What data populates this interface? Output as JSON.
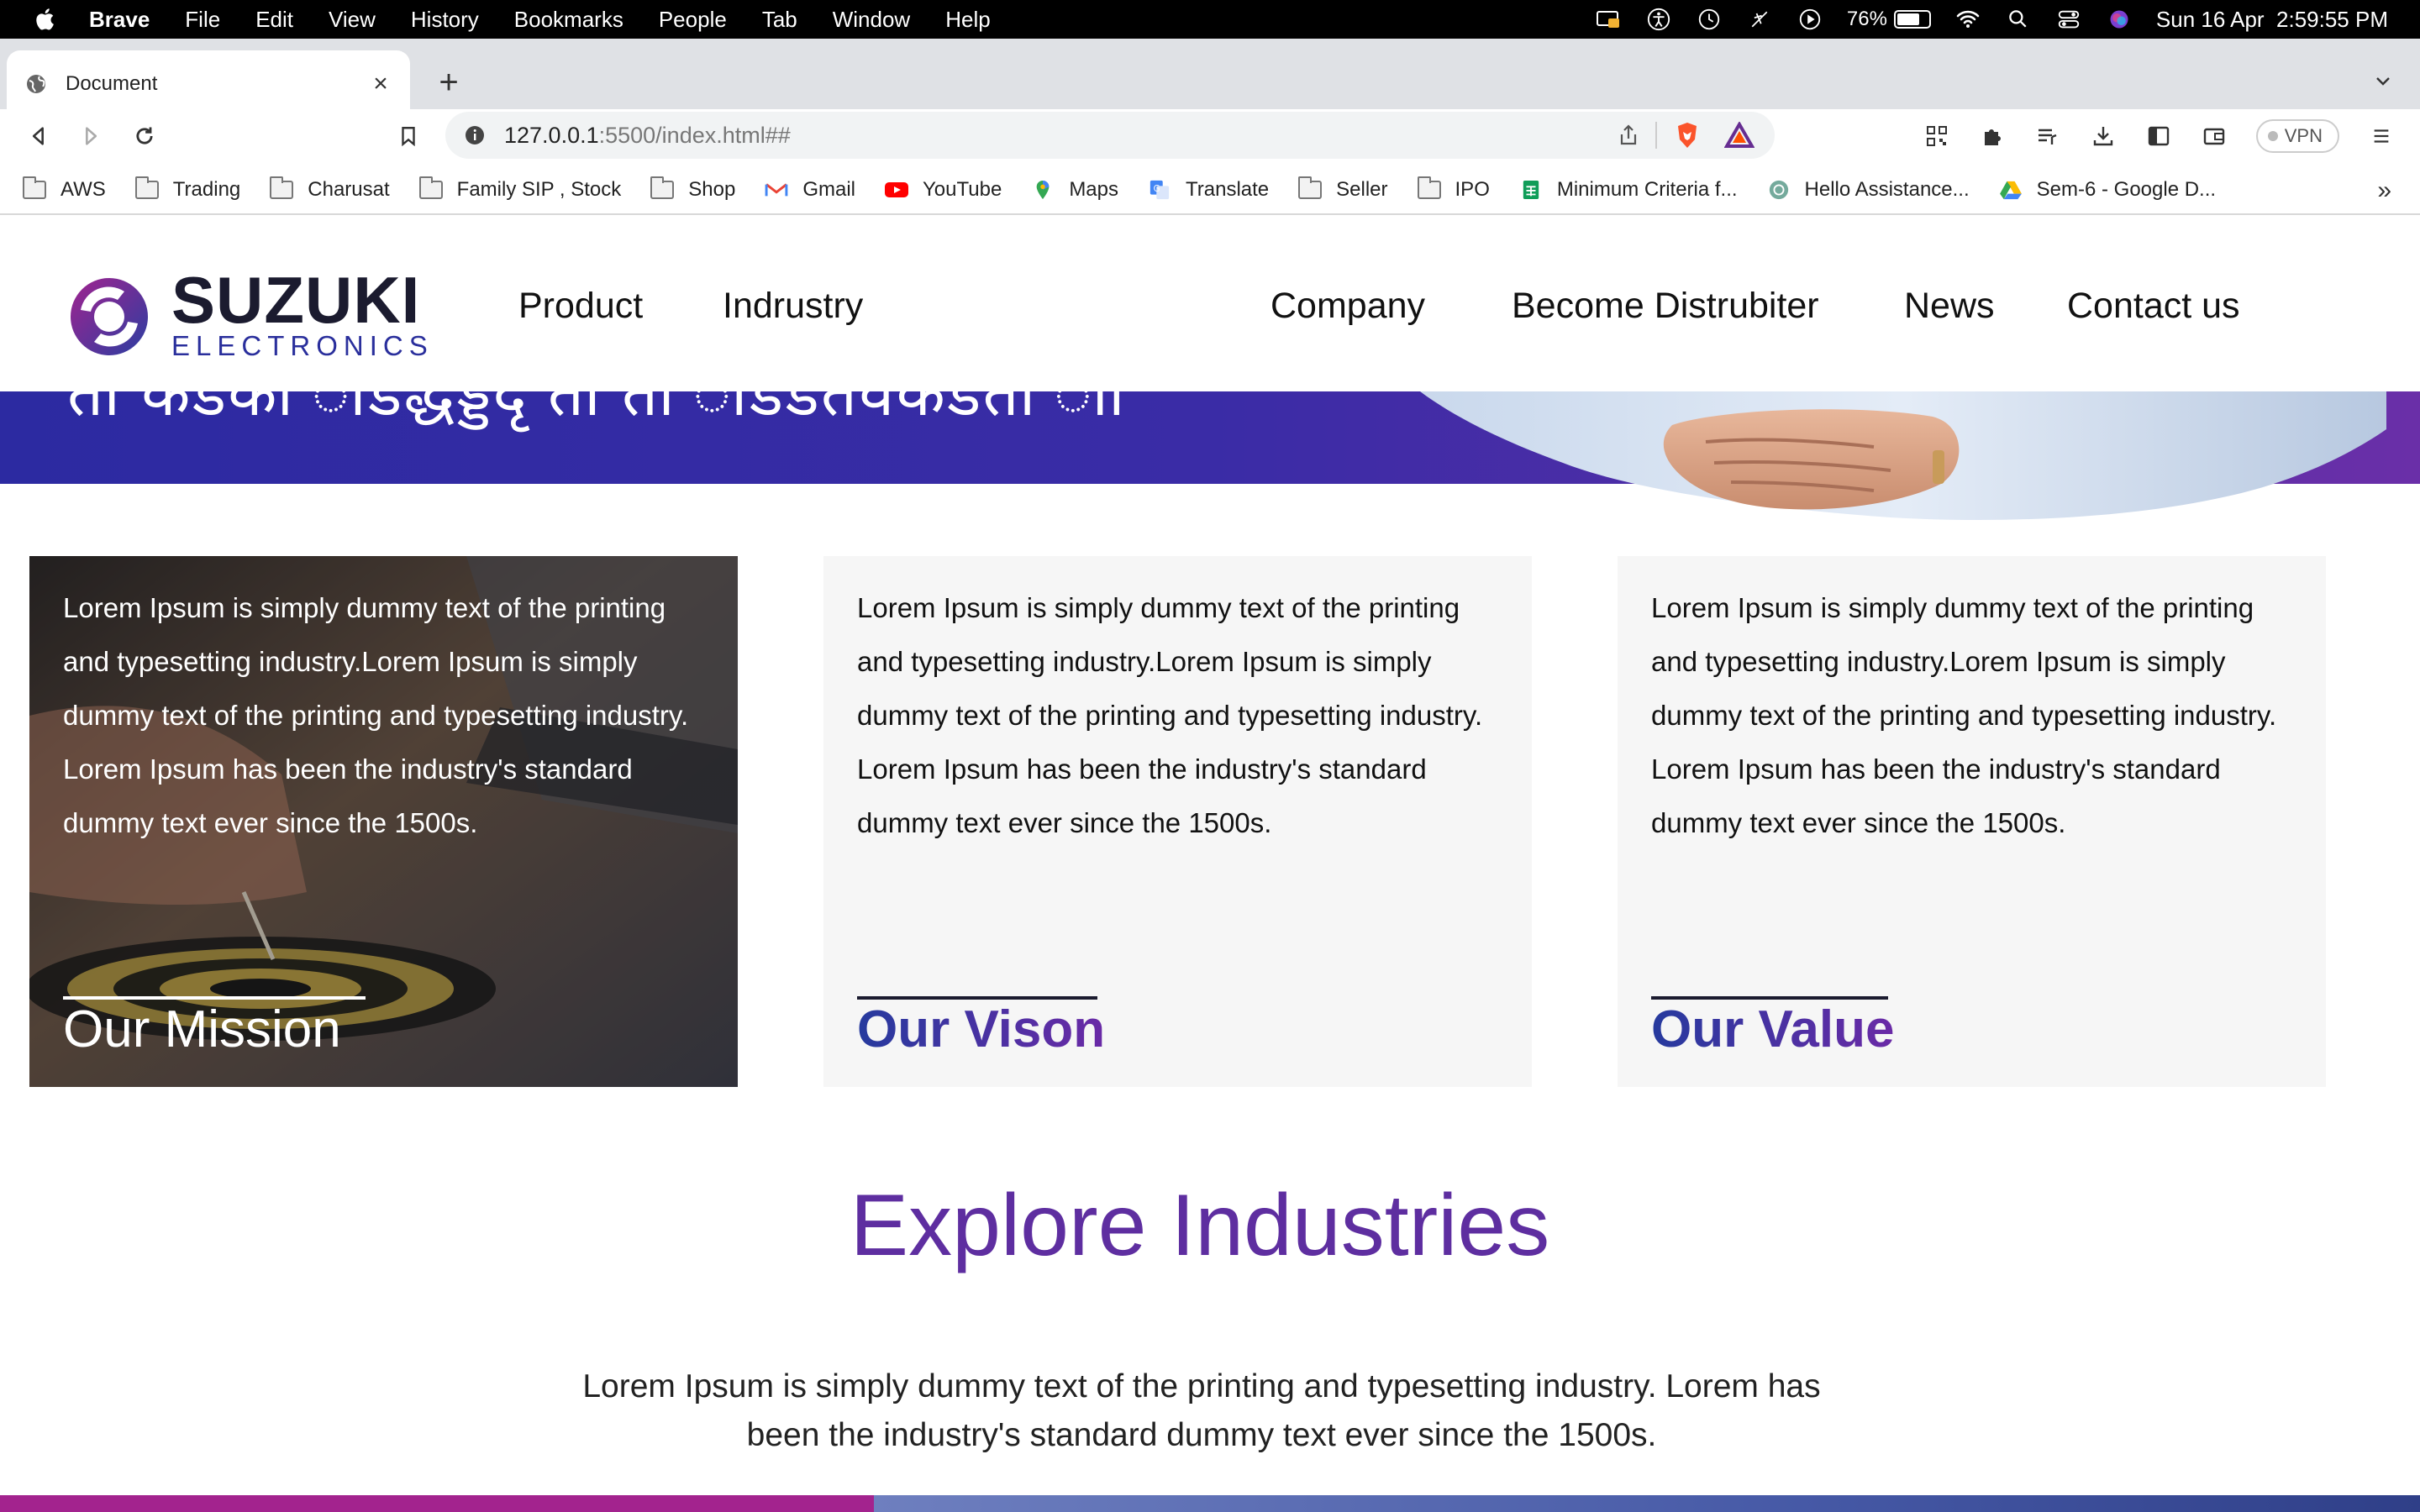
{
  "menubar": {
    "app": "Brave",
    "items": [
      "File",
      "Edit",
      "View",
      "History",
      "Bookmarks",
      "People",
      "Tab",
      "Window",
      "Help"
    ],
    "battery_percent": "76%",
    "battery_level": 0.76,
    "datetime": "Sun 16 Apr  2:59:55 PM"
  },
  "tab": {
    "title": "Document"
  },
  "toolbar": {
    "url_host": "127.0.0.1",
    "url_rest": ":5500/index.html##",
    "vpn_label": "VPN"
  },
  "bookmarks": [
    {
      "label": "AWS",
      "icon": "folder-icon"
    },
    {
      "label": "Trading",
      "icon": "folder-icon"
    },
    {
      "label": "Charusat",
      "icon": "folder-icon"
    },
    {
      "label": "Family SIP , Stock",
      "icon": "folder-icon"
    },
    {
      "label": "Shop",
      "icon": "folder-icon"
    },
    {
      "label": "Gmail",
      "icon": "gmail-icon"
    },
    {
      "label": "YouTube",
      "icon": "youtube-icon"
    },
    {
      "label": "Maps",
      "icon": "maps-icon"
    },
    {
      "label": "Translate",
      "icon": "translate-icon"
    },
    {
      "label": "Seller",
      "icon": "folder-icon"
    },
    {
      "label": "IPO",
      "icon": "folder-icon"
    },
    {
      "label": "Minimum Criteria f...",
      "icon": "sheets-icon"
    },
    {
      "label": "Hello Assistance...",
      "icon": "chatgpt-icon"
    },
    {
      "label": "Sem-6 - Google D...",
      "icon": "drive-icon"
    }
  ],
  "site": {
    "logo_brand": "SUZUKI",
    "logo_sub": "ELECTRONICS",
    "nav": [
      "Product",
      "Indrustry",
      "Company",
      "Become Distrubiter",
      "News",
      "Contact us"
    ],
    "hero_partial_text": "ता कडका ाडद्धैड्डेदृ ता ता ाडडतवकडता ाा"
  },
  "cards": [
    {
      "text": "Lorem Ipsum is simply dummy text of the printing and typesetting industry.Lorem Ipsum is simply dummy text of the printing and typesetting industry. Lorem Ipsum has been the industry's standard dummy text ever since the 1500s.",
      "title": "Our Mission"
    },
    {
      "text": "Lorem Ipsum is simply dummy text of the printing and typesetting industry.Lorem Ipsum is simply dummy text of the printing and typesetting industry. Lorem Ipsum has been the industry's standard dummy text ever since the 1500s.",
      "title": "Our Vison"
    },
    {
      "text": "Lorem Ipsum is simply dummy text of the printing and typesetting industry.Lorem Ipsum is simply dummy text of the printing and typesetting industry. Lorem Ipsum has been the industry's standard dummy text ever since the 1500s.",
      "title": "Our Value"
    }
  ],
  "explore": {
    "title": "Explore Industries",
    "text": "Lorem Ipsum is simply dummy text of the printing and typesetting industry. Lorem has been the industry's standard dummy text ever since the 1500s."
  },
  "colors": {
    "brand_blue": "#263a9e",
    "brand_purple": "#6a2aa6",
    "hero_gradient_start": "#2c2aa1",
    "hero_gradient_end": "#6a2fa8",
    "explore_title": "#5e2ea0",
    "bottom_left_strip": "#a3238e"
  }
}
